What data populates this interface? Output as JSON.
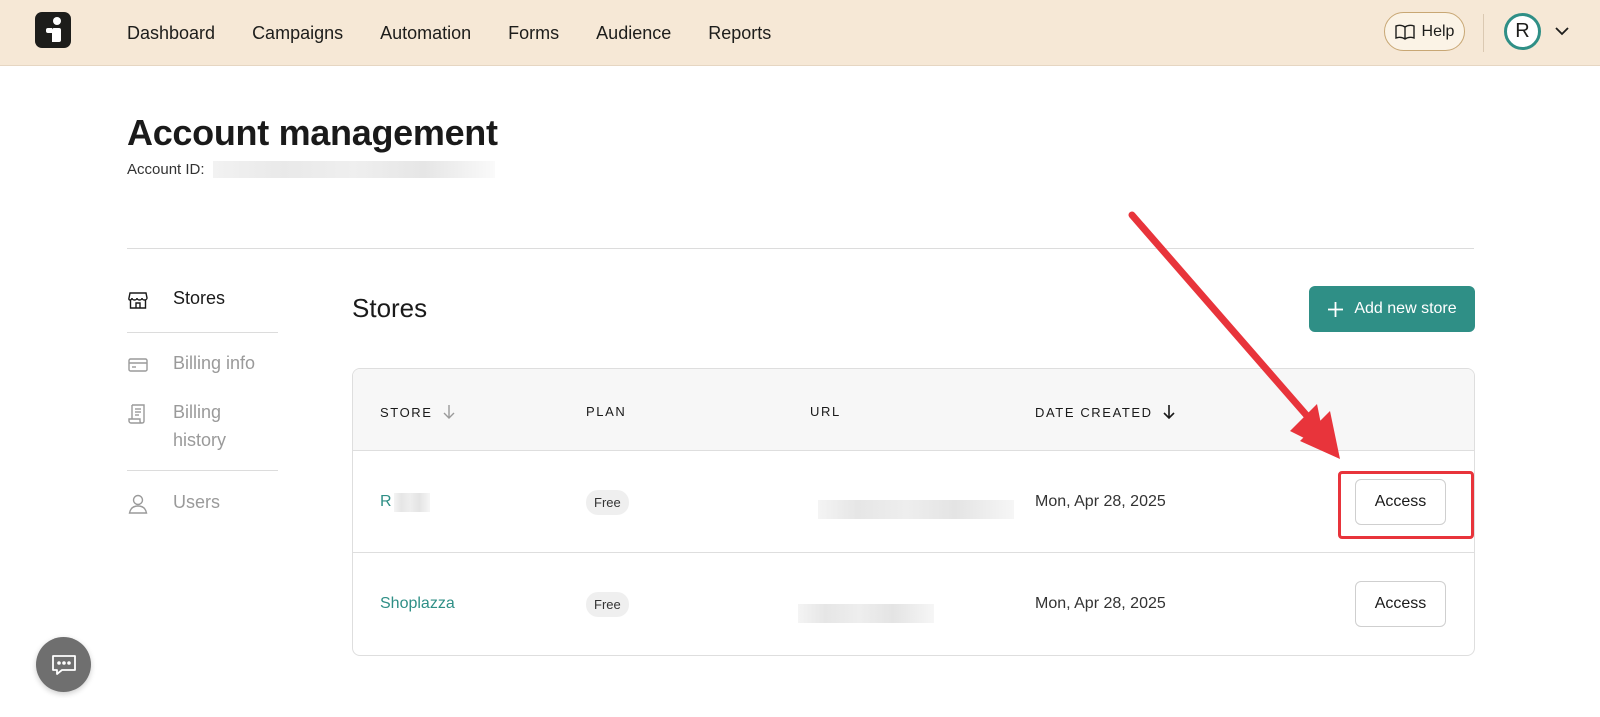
{
  "nav": {
    "items": [
      "Dashboard",
      "Campaigns",
      "Automation",
      "Forms",
      "Audience",
      "Reports"
    ],
    "help_label": "Help",
    "avatar_initial": "R"
  },
  "page": {
    "title": "Account management",
    "account_id_label": "Account ID:"
  },
  "sidebar": {
    "items": [
      {
        "label": "Stores",
        "icon": "store-icon",
        "active": true
      },
      {
        "label": "Billing info",
        "icon": "credit-card-icon",
        "active": false
      },
      {
        "label": "Billing history",
        "icon": "receipt-icon",
        "active": false
      },
      {
        "label": "Users",
        "icon": "user-icon",
        "active": false
      }
    ]
  },
  "stores": {
    "title": "Stores",
    "add_button_label": "Add new store",
    "columns": [
      "STORE",
      "PLAN",
      "URL",
      "DATE CREATED"
    ],
    "rows": [
      {
        "store": "R",
        "plan": "Free",
        "date": "Mon, Apr 28, 2025",
        "action": "Access"
      },
      {
        "store": "Shoplazza",
        "plan": "Free",
        "date": "Mon, Apr 28, 2025",
        "action": "Access"
      }
    ]
  },
  "colors": {
    "accent": "#2f8f86",
    "topbar": "#f6e8d6",
    "annotation": "#e8343b"
  }
}
